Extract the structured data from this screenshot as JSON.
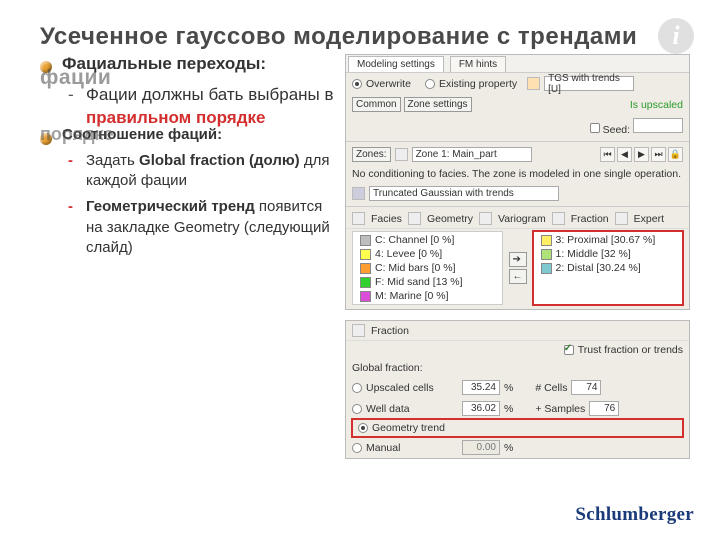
{
  "title": "Усеченное гауссово моделирование с трендами",
  "overlay": "фации",
  "bullet1": "Фациальные переходы:",
  "dash1_a": "Фации должны бать выбраны в ",
  "dash1_red": "правильном порядке",
  "overlay2": "порядке",
  "bullet2": "Соотношение фаций:",
  "dash2a_pre": "Задать ",
  "dash2a_bold": "Global fraction (долю)",
  "dash2a_post": " для каждой фации",
  "dash2b_bold": "Геометрический тренд",
  "dash2b_post": " появится на закладке Geometry (следующий слайд)",
  "footer_brand": "Schlumberger",
  "panel1": {
    "tabs": [
      "Modeling settings",
      "FM hints"
    ],
    "overwrite": "Overwrite",
    "existing": "Existing property",
    "prop_value": "TGS with trends [U]",
    "status": "Is upscaled",
    "common": "Common",
    "zone_settings": "Zone settings",
    "seed": "Seed:",
    "seed_value": "",
    "zones": "Zones:",
    "zone_name": "Zone 1: Main_part",
    "cond_label": "No conditioning to facies. The zone is modeled in one single operation.",
    "method_label": "Truncated Gaussian with trends",
    "tabrow": [
      "Facies",
      "Geometry",
      "Variogram",
      "Fraction",
      "Expert"
    ],
    "facies_left": [
      {
        "color": "#bdbdbd",
        "label": "C: Channel [0 %]"
      },
      {
        "color": "#ffff4d",
        "label": "4: Levee [0 %]"
      },
      {
        "color": "#ff9d2e",
        "label": "C: Mid bars [0 %]"
      },
      {
        "color": "#2fd12f",
        "label": "F: Mid sand [13 %]"
      },
      {
        "color": "#d94dd9",
        "label": "M: Marine [0 %]"
      }
    ],
    "facies_right": [
      {
        "color": "#ffef66",
        "label": "3: Proximal [30.67 %]"
      },
      {
        "color": "#b0e27a",
        "label": "1: Middle [32   %]"
      },
      {
        "color": "#80c8d0",
        "label": "2: Distal [30.24 %]"
      }
    ]
  },
  "panel2": {
    "tab": "Fraction",
    "trust_label": "Trust fraction or trends",
    "global_label": "Global fraction:",
    "r1": "Upscaled cells",
    "r1v": "35.24",
    "r1c_label": "# Cells",
    "r1c": "74",
    "r2": "Well data",
    "r2v": "36.02",
    "r2c_label": "+ Samples",
    "r2c": "76",
    "r3": "Geometry trend",
    "r4": "Manual",
    "r4v": "0.00"
  }
}
